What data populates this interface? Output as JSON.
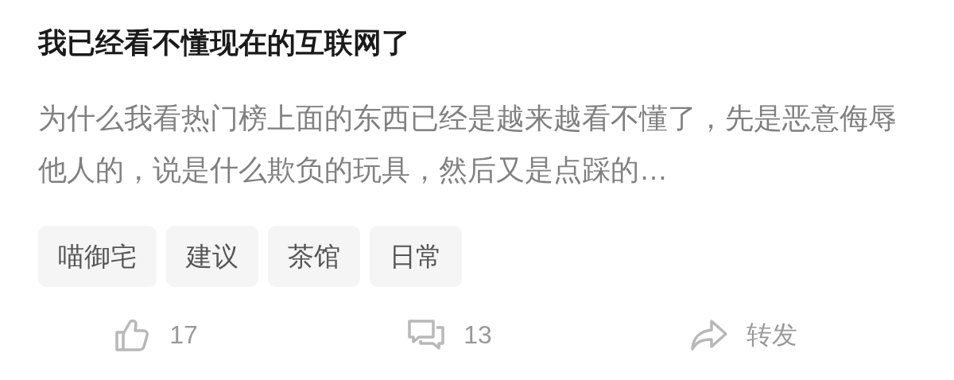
{
  "title": "我已经看不懂现在的互联网了",
  "excerpt": "为什么我看热门榜上面的东西已经是越来越看不懂了，先是恶意侮辱他人的，说是什么欺负的玩具，然后又是点踩的…",
  "tags": [
    "喵御宅",
    "建议",
    "茶馆",
    "日常"
  ],
  "actions": [
    {
      "kind": "like",
      "label": "17"
    },
    {
      "kind": "comment",
      "label": "13"
    },
    {
      "kind": "share",
      "label": "转发"
    }
  ]
}
